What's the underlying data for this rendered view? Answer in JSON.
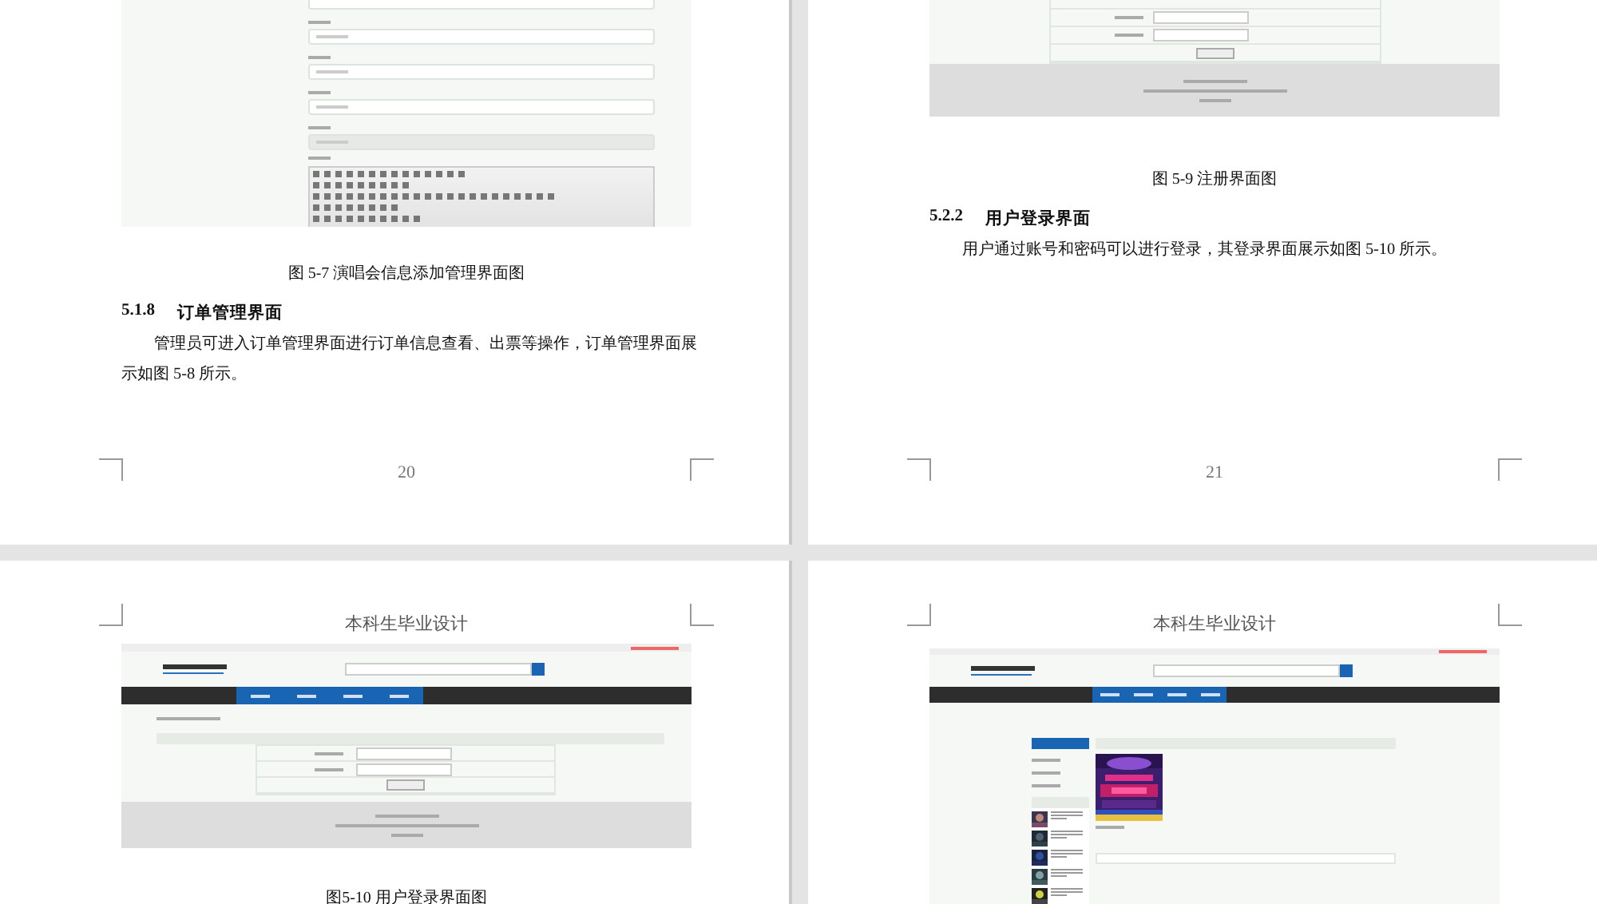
{
  "pages": [
    {
      "kind": "body",
      "screenshot": {
        "kind": "admin-form"
      },
      "caption": "图 5-7 演唱会信息添加管理界面图",
      "heading_number": "5.1.8",
      "heading": "订单管理界面",
      "paragraph": "管理员可进入订单管理界面进行订单信息查看、出票等操作，订单管理界面展示如图 5-8 所示。",
      "number": "20"
    },
    {
      "kind": "body",
      "screenshot": {
        "kind": "register-form"
      },
      "caption": "图 5-9 注册界面图",
      "heading_number": "5.2.2",
      "heading": "用户登录界面",
      "paragraph": "用户通过账号和密码可以进行登录，其登录界面展示如图 5-10 所示。",
      "number": "21"
    },
    {
      "kind": "top",
      "header": "本科生毕业设计",
      "screenshot": {
        "kind": "login-page"
      },
      "caption": "图5-10 用户登录界面图"
    },
    {
      "kind": "top",
      "header": "本科生毕业设计",
      "screenshot": {
        "kind": "list-page"
      }
    }
  ]
}
